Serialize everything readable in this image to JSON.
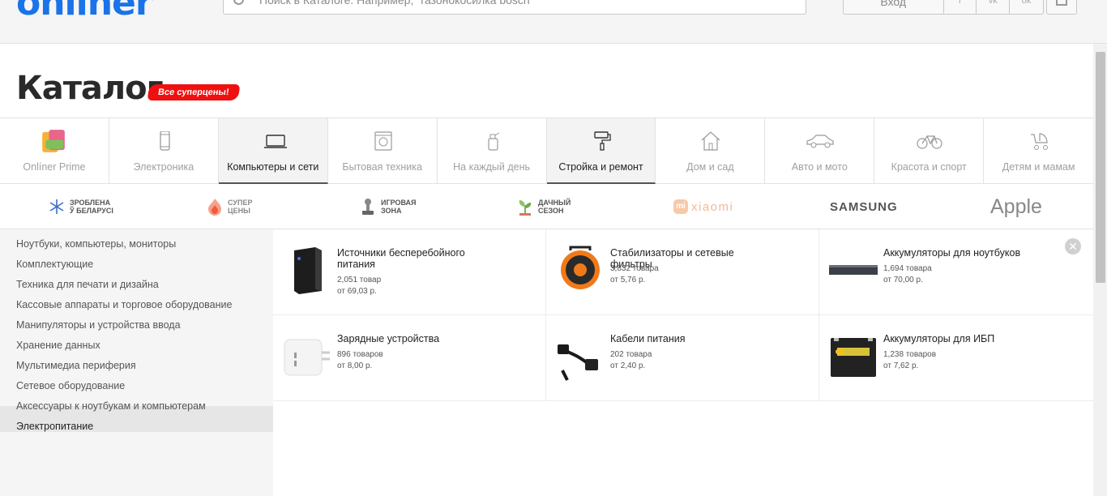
{
  "header": {
    "logo": "onliner",
    "search_placeholder": "Поиск в Каталоге. Например, \"газонокосилка bosch\"",
    "login_label": "Вход",
    "social": [
      "f",
      "vk",
      "ok"
    ]
  },
  "page": {
    "title": "Каталог",
    "badge": "Все суперцены!"
  },
  "categories": [
    {
      "label": "Onlíner Prime",
      "icon": "prime-icon",
      "active": false
    },
    {
      "label": "Электроника",
      "icon": "phone-icon",
      "active": false
    },
    {
      "label": "Компьютеры и сети",
      "icon": "laptop-icon",
      "active": true
    },
    {
      "label": "Бытовая техника",
      "icon": "washer-icon",
      "active": false
    },
    {
      "label": "На каждый день",
      "icon": "spray-icon",
      "active": false
    },
    {
      "label": "Стройка и ремонт",
      "icon": "paint-roller-icon",
      "active": true
    },
    {
      "label": "Дом и сад",
      "icon": "house-icon",
      "active": false
    },
    {
      "label": "Авто и мото",
      "icon": "car-icon",
      "active": false
    },
    {
      "label": "Красота и спорт",
      "icon": "bicycle-icon",
      "active": false
    },
    {
      "label": "Детям и мамам",
      "icon": "stroller-icon",
      "active": false
    }
  ],
  "promos": [
    {
      "text": "Зроблена\nў Беларусі",
      "icon": "snowflake-icon"
    },
    {
      "text": "Супер\nцены",
      "icon": "flame-icon"
    },
    {
      "text": "Игровая\nзона",
      "icon": "joystick-icon"
    },
    {
      "text": "Дачный\nсезон",
      "icon": "sprout-icon"
    },
    {
      "text": "xiaomi",
      "icon": "mi-icon"
    },
    {
      "text": "SAMSUNG",
      "icon": ""
    },
    {
      "text": "Apple",
      "icon": ""
    }
  ],
  "sidebar": {
    "items": [
      "Ноутбуки, компьютеры, мониторы",
      "Комплектующие",
      "Техника для печати и дизайна",
      "Кассовые аппараты и торговое оборудование",
      "Манипуляторы и устройства ввода",
      "Хранение данных",
      "Мультимедиа периферия",
      "Сетевое оборудование",
      "Аксессуары к ноутбукам и компьютерам",
      "Электропитание"
    ],
    "active_index": 9
  },
  "products": [
    {
      "name": "Источники бесперебойного питания",
      "count": "2,051 товар",
      "price": "от 69,03 р.",
      "icon": "ups-icon"
    },
    {
      "name": "Стабилизаторы и сетевые фильтры",
      "count": "3,832 товара",
      "price": "от 5,76 р.",
      "icon": "cable-reel-icon"
    },
    {
      "name": "Аккумуляторы для ноутбуков",
      "count": "1,694 товара",
      "price": "от 70,00 р.",
      "icon": "laptop-battery-icon"
    },
    {
      "name": "Зарядные устройства",
      "count": "896 товаров",
      "price": "от 8,00 р.",
      "icon": "charger-icon"
    },
    {
      "name": "Кабели питания",
      "count": "202 товара",
      "price": "от 2,40 р.",
      "icon": "power-cable-icon"
    },
    {
      "name": "Аккумуляторы для ИБП",
      "count": "1,238 товаров",
      "price": "от 7,62 р.",
      "icon": "ups-battery-icon"
    }
  ],
  "colors": {
    "brand": "#1a73e8",
    "badge": "#f01010",
    "active_tab": "#f3f3f3"
  }
}
